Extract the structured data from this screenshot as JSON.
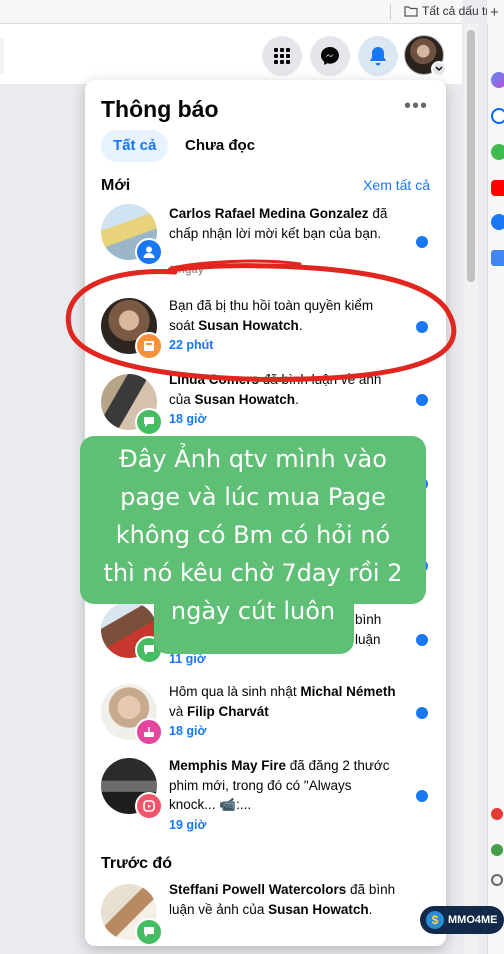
{
  "browser": {
    "bookmark_folder": "Tất cả dấu tran"
  },
  "panel": {
    "title": "Thông báo",
    "more": "•••",
    "tabs": [
      {
        "label": "Tất cả",
        "active": true
      },
      {
        "label": "Chưa đọc",
        "active": false
      }
    ],
    "section_new": "Mới",
    "see_all": "Xem tất cả",
    "section_earlier": "Trước đó"
  },
  "notifications": [
    {
      "parts": [
        "Carlos Rafael Medina Gonzalez",
        " đã chấp nhận lời mời kết bạn của bạn."
      ],
      "time": "1 ngày",
      "badge": "friend",
      "badge_color": "#1877f2",
      "unread": true
    },
    {
      "parts": [
        "",
        "Bạn đã bị thu hồi toàn quyền kiểm soát ",
        "Susan Howatch",
        "."
      ],
      "time": "22 phút",
      "badge": "page",
      "badge_color": "#f7923a",
      "unread": true
    },
    {
      "parts": [
        "Linda Comers",
        " đã bình luận về ảnh của ",
        "Susan Howatch",
        "."
      ],
      "time": "18 giờ",
      "badge": "comment",
      "badge_color": "#45bd62",
      "unread": true
    },
    {
      "parts": [
        "",
        "bình luận"
      ],
      "time": "11 giờ",
      "badge": "comment",
      "badge_color": "#45bd62",
      "unread": true
    },
    {
      "parts": [
        "",
        "Hôm qua là sinh nhật ",
        "Michal Németh",
        " và ",
        "Filip Charvát"
      ],
      "time": "18 giờ",
      "badge": "birthday",
      "badge_color": "#e4479d",
      "unread": true
    },
    {
      "parts": [
        "Memphis May Fire",
        " đã đăng 2 thước phim mới, trong đó có \"Always knock... 📹:..."
      ],
      "time": "19 giờ",
      "badge": "reels",
      "badge_color": "#f2556b",
      "unread": true
    },
    {
      "parts": [
        "Steffani Powell Watercolors",
        " đã bình luận về ảnh của ",
        "Susan Howatch",
        "."
      ],
      "time": "",
      "badge": "comment",
      "badge_color": "#45bd62",
      "unread": true
    }
  ],
  "overlay": {
    "note_lines": [
      "Đây Ảnh qtv mình vào",
      "page và lúc mua Page",
      "không có Bm có hỏi nó",
      "thì nó kêu chờ 7day rồi 2",
      "ngày cút luôn"
    ],
    "watermark": "MMO4ME"
  }
}
